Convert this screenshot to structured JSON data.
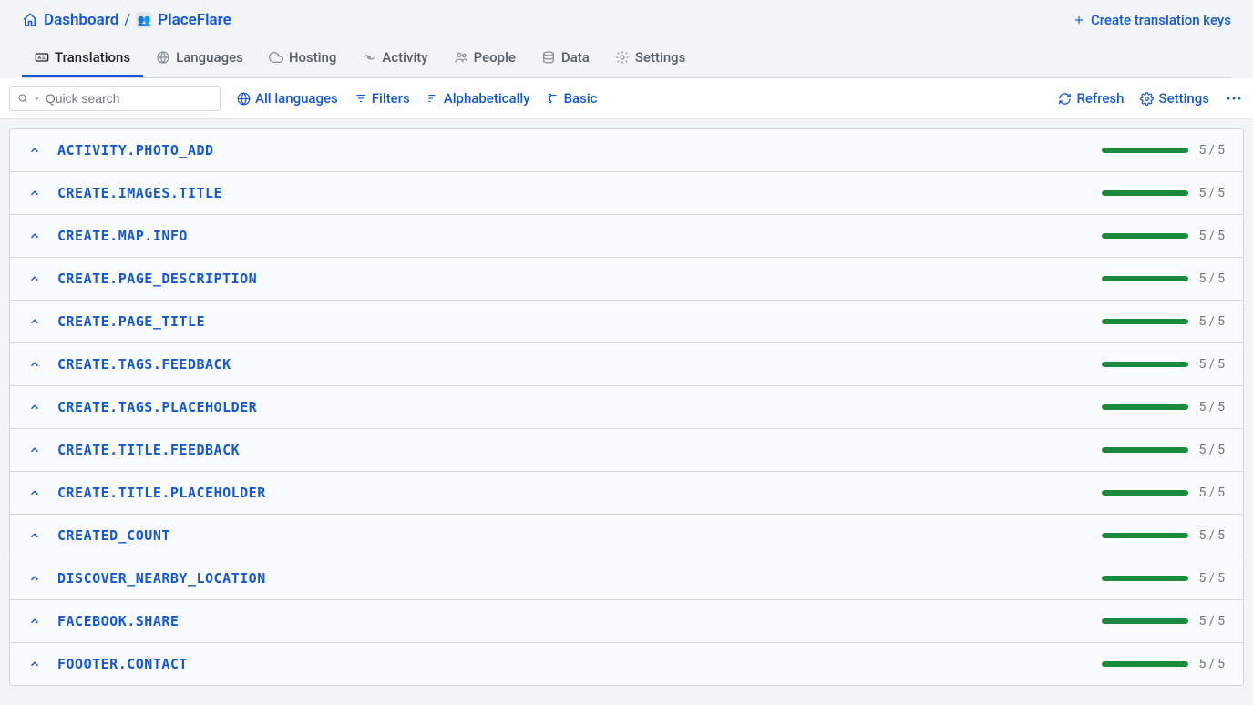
{
  "breadcrumb": {
    "dashboard": "Dashboard",
    "project": "PlaceFlare",
    "project_emoji": "👥"
  },
  "header_actions": {
    "create_key": "Create translation keys"
  },
  "tabs": [
    {
      "id": "translations",
      "label": "Translations",
      "active": true
    },
    {
      "id": "languages",
      "label": "Languages",
      "active": false
    },
    {
      "id": "hosting",
      "label": "Hosting",
      "active": false
    },
    {
      "id": "activity",
      "label": "Activity",
      "active": false
    },
    {
      "id": "people",
      "label": "People",
      "active": false
    },
    {
      "id": "data",
      "label": "Data",
      "active": false
    },
    {
      "id": "settings",
      "label": "Settings",
      "active": false
    }
  ],
  "toolbar": {
    "search_placeholder": "Quick search",
    "all_languages": "All languages",
    "filters": "Filters",
    "alphabetically": "Alphabetically",
    "basic": "Basic",
    "refresh": "Refresh",
    "settings": "Settings"
  },
  "keys": [
    {
      "name": "ACTIVITY.PHOTO_ADD",
      "done": 5,
      "total": 5
    },
    {
      "name": "CREATE.IMAGES.TITLE",
      "done": 5,
      "total": 5
    },
    {
      "name": "CREATE.MAP.INFO",
      "done": 5,
      "total": 5
    },
    {
      "name": "CREATE.PAGE_DESCRIPTION",
      "done": 5,
      "total": 5
    },
    {
      "name": "CREATE.PAGE_TITLE",
      "done": 5,
      "total": 5
    },
    {
      "name": "CREATE.TAGS.FEEDBACK",
      "done": 5,
      "total": 5
    },
    {
      "name": "CREATE.TAGS.PLACEHOLDER",
      "done": 5,
      "total": 5
    },
    {
      "name": "CREATE.TITLE.FEEDBACK",
      "done": 5,
      "total": 5
    },
    {
      "name": "CREATE.TITLE.PLACEHOLDER",
      "done": 5,
      "total": 5
    },
    {
      "name": "CREATED_COUNT",
      "done": 5,
      "total": 5
    },
    {
      "name": "DISCOVER_NEARBY_LOCATION",
      "done": 5,
      "total": 5
    },
    {
      "name": "FACEBOOK.SHARE",
      "done": 5,
      "total": 5
    },
    {
      "name": "FOOOTER.CONTACT",
      "done": 5,
      "total": 5
    }
  ]
}
